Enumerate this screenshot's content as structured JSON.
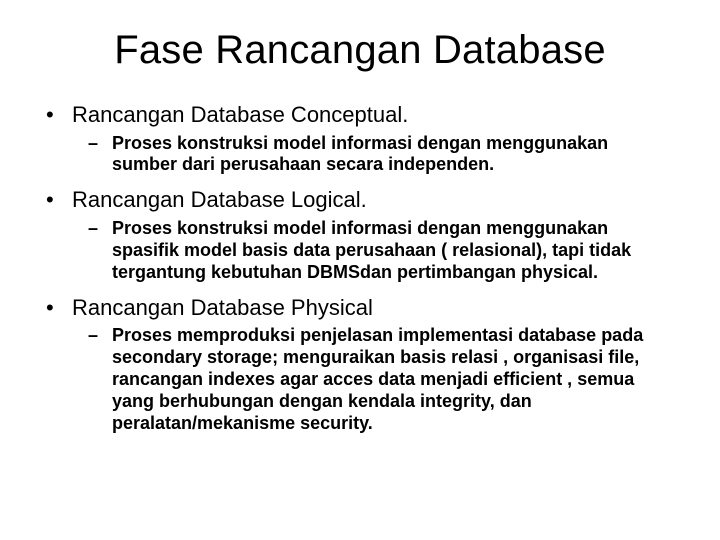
{
  "title": "Fase Rancangan Database",
  "items": [
    {
      "heading": "Rancangan Database Conceptual.",
      "sub": [
        "Proses konstruksi model informasi dengan menggunakan sumber dari perusahaan secara independen."
      ]
    },
    {
      "heading": "Rancangan Database Logical.",
      "sub": [
        "Proses konstruksi model informasi dengan menggunakan spasifik model basis data perusahaan ( relasional), tapi tidak tergantung kebutuhan DBMSdan pertimbangan physical."
      ]
    },
    {
      "heading": "Rancangan Database Physical",
      "sub": [
        "Proses memproduksi penjelasan implementasi database pada secondary storage; menguraikan basis relasi , organisasi file, rancangan indexes agar acces data menjadi efficient , semua yang berhubungan dengan kendala integrity, dan peralatan/mekanisme security."
      ]
    }
  ]
}
